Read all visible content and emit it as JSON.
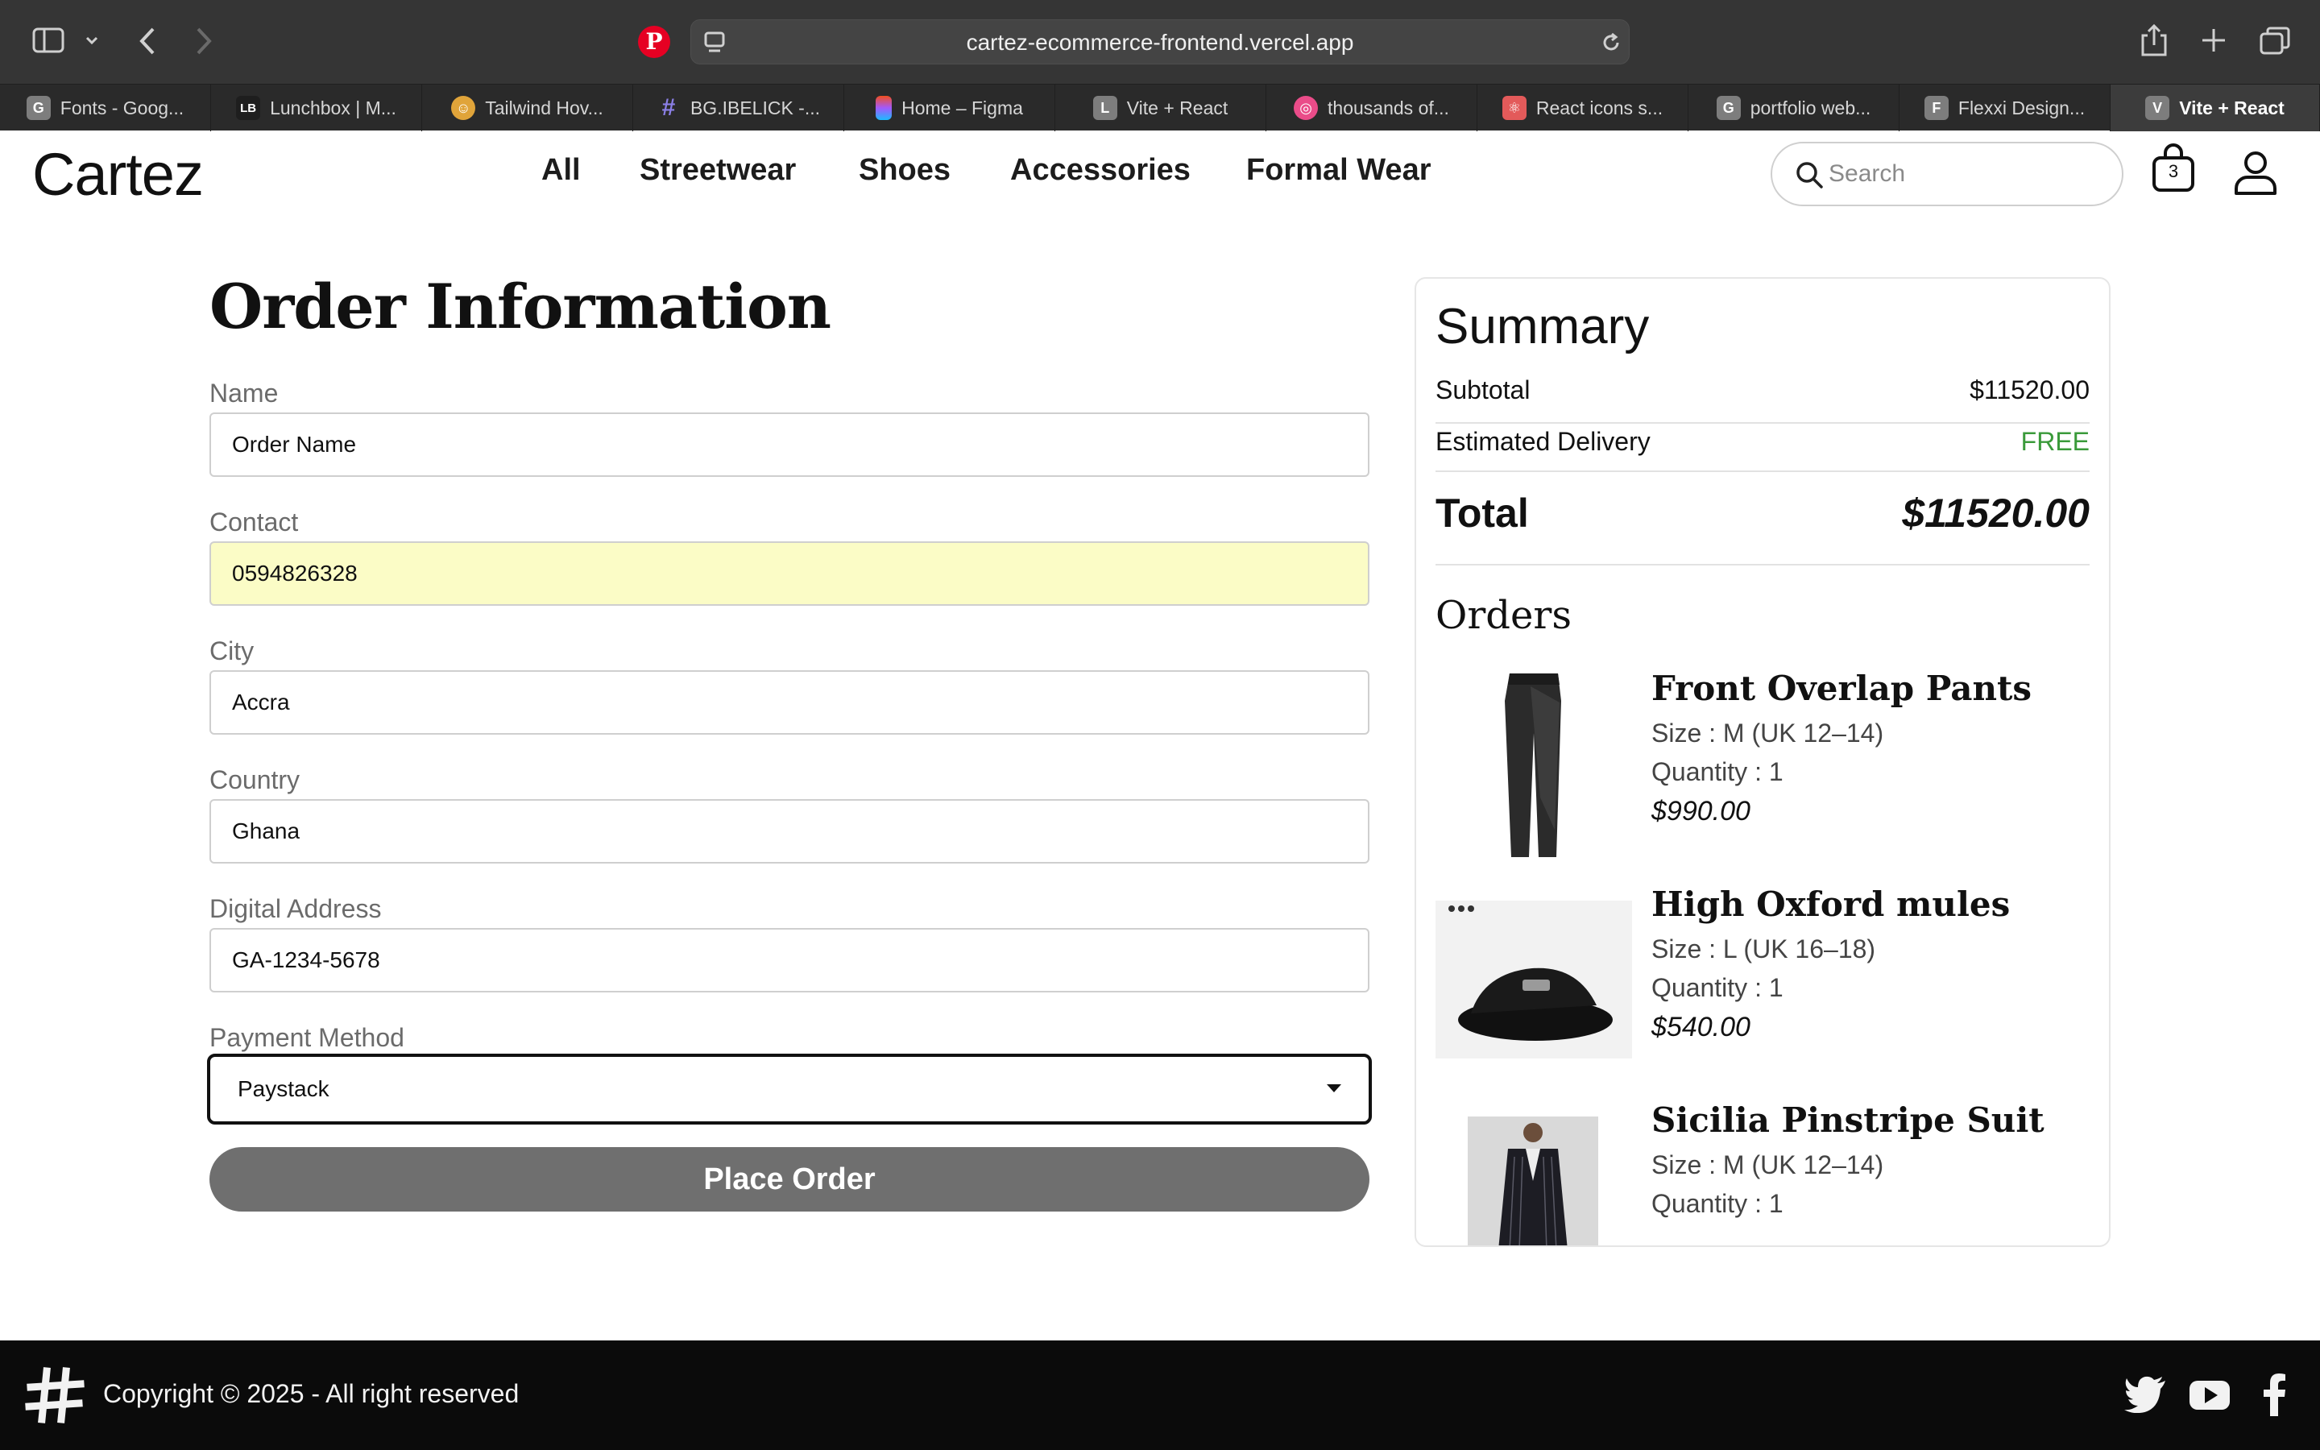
{
  "browser": {
    "url": "cartez-ecommerce-frontend.vercel.app",
    "tabs": [
      {
        "label": "Fonts - Goog...",
        "icon_letter": "G",
        "icon_color": "#8a8a8a"
      },
      {
        "label": "Lunchbox | M...",
        "icon_letter": "LB",
        "icon_color": "#2a2a2a"
      },
      {
        "label": "Tailwind Hov...",
        "icon_letter": "☺",
        "icon_color": "#e0a43a"
      },
      {
        "label": "BG.IBELICK -...",
        "icon_letter": "#",
        "icon_color": "#6a5fd6"
      },
      {
        "label": "Home – Figma",
        "icon_letter": "F",
        "icon_color": "#a259ff"
      },
      {
        "label": "Vite + React",
        "icon_letter": "L",
        "icon_color": "#8a8a8a"
      },
      {
        "label": "thousands of...",
        "icon_letter": "◎",
        "icon_color": "#ea4c89"
      },
      {
        "label": "React icons s...",
        "icon_letter": "⚛",
        "icon_color": "#e35a5a"
      },
      {
        "label": "portfolio web...",
        "icon_letter": "G",
        "icon_color": "#8a8a8a"
      },
      {
        "label": "Flexxi Design...",
        "icon_letter": "F",
        "icon_color": "#8a8a8a"
      },
      {
        "label": "Vite + React",
        "icon_letter": "V",
        "icon_color": "#8a8a8a",
        "active": true
      }
    ]
  },
  "header": {
    "logo": "Cartez",
    "nav": [
      "All",
      "Streetwear",
      "Shoes",
      "Accessories",
      "Formal Wear"
    ],
    "search_placeholder": "Search",
    "cart_count": "3"
  },
  "form": {
    "title": "Order Information",
    "fields": [
      {
        "label": "Name",
        "value": "Order Name"
      },
      {
        "label": "Contact",
        "value": "0594826328"
      },
      {
        "label": "City",
        "value": "Accra"
      },
      {
        "label": "Country",
        "value": "Ghana"
      },
      {
        "label": "Digital Address",
        "value": "GA-1234-5678"
      }
    ],
    "payment_label": "Payment Method",
    "payment_value": "Paystack",
    "submit_label": "Place Order"
  },
  "summary": {
    "title": "Summary",
    "subtotal_label": "Subtotal",
    "subtotal_value": "$11520.00",
    "delivery_label": "Estimated Delivery",
    "delivery_value": "FREE",
    "total_label": "Total",
    "total_value": "$11520.00",
    "orders_title": "Orders",
    "items": [
      {
        "name": "Front Overlap Pants",
        "size": "Size : M (UK 12–14)",
        "quantity": "Quantity : 1",
        "price": "$990.00"
      },
      {
        "name": "High Oxford mules",
        "size": "Size : L (UK 16–18)",
        "quantity": "Quantity : 1",
        "price": "$540.00"
      },
      {
        "name": "Sicilia Pinstripe Suit",
        "size": "Size : M (UK 12–14)",
        "quantity": "Quantity : 1",
        "price": ""
      }
    ]
  },
  "footer": {
    "copyright": "Copyright © 2025 - All right reserved"
  },
  "colors": {
    "toolbar": "#353535",
    "autofill": "#fbfcc6",
    "button": "#6f6f6f",
    "free": "#3a9a3a",
    "footer": "#0b0b0b"
  }
}
